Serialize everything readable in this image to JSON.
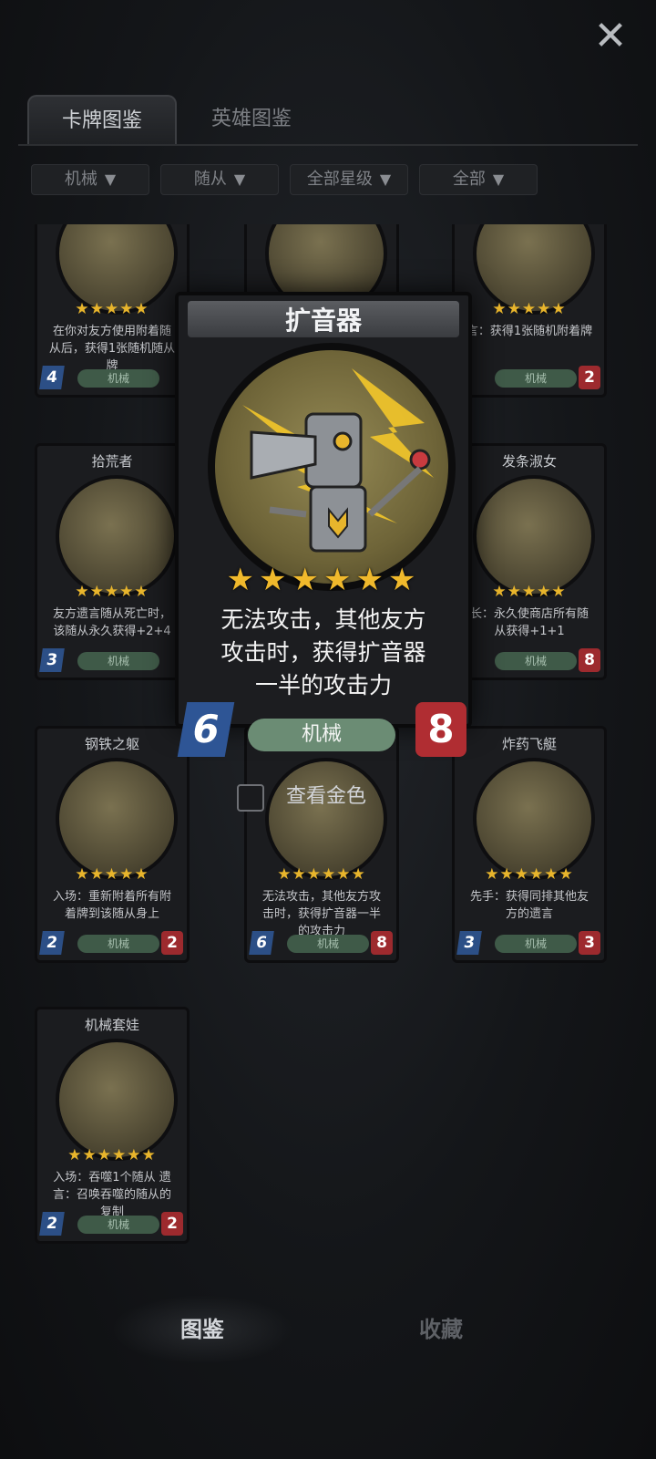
{
  "header": {
    "close_icon": "close-x-icon"
  },
  "tabs": [
    {
      "label": "卡牌图鉴"
    },
    {
      "label": "英雄图鉴"
    }
  ],
  "filters": [
    {
      "label": "机械"
    },
    {
      "label": "随从"
    },
    {
      "label": "全部星级"
    },
    {
      "label": "全部"
    }
  ],
  "cards": [
    {
      "name": "",
      "desc": "在你对友方使用附着随从后，获得1张随机随从牌",
      "tribe": "机械",
      "attack": "4",
      "health": ""
    },
    {
      "name": "",
      "desc": "",
      "tribe": "",
      "attack": "",
      "health": ""
    },
    {
      "name": "",
      "desc": "言：获得1张随机附着牌",
      "tribe": "机械",
      "attack": "",
      "health": "2"
    },
    {
      "name": "拾荒者",
      "desc": "友方遗言随从死亡时，该随从永久获得+2+4",
      "tribe": "机械",
      "attack": "3",
      "health": ""
    },
    {
      "name": "发条淑女",
      "desc": "长：永久使商店所有随从获得+1+1",
      "tribe": "机械",
      "attack": "",
      "health": "8"
    },
    {
      "name": "钢铁之躯",
      "desc": "入场：重新附着所有附着牌到该随从身上",
      "tribe": "机械",
      "attack": "2",
      "health": "2"
    },
    {
      "name": "",
      "desc": "无法攻击，其他友方攻击时，获得扩音器一半的攻击力",
      "tribe": "机械",
      "attack": "6",
      "health": "8"
    },
    {
      "name": "炸药飞艇",
      "desc": "先手：获得同排其他友方的遗言",
      "tribe": "机械",
      "attack": "3",
      "health": "3"
    },
    {
      "name": "机械套娃",
      "desc": "入场：吞噬1个随从 遗言：召唤吞噬的随从的复制",
      "tribe": "机械",
      "attack": "2",
      "health": "2"
    }
  ],
  "popup": {
    "title": "扩音器",
    "stars": "★★★★★★",
    "desc_lines": [
      "无法攻击，其他友方",
      "攻击时，获得扩音器",
      "一半的攻击力"
    ],
    "attack": "6",
    "tribe": "机械",
    "health": "8"
  },
  "gold_toggle": {
    "label": "查看金色",
    "checked": false
  },
  "bottom_nav": [
    {
      "label": "图鉴"
    },
    {
      "label": "收藏"
    }
  ],
  "colors": {
    "accent_gold": "#e8b52c",
    "attack_blue": "#2e5595",
    "health_red": "#b02d32",
    "tribe_green": "#6b8c74"
  }
}
